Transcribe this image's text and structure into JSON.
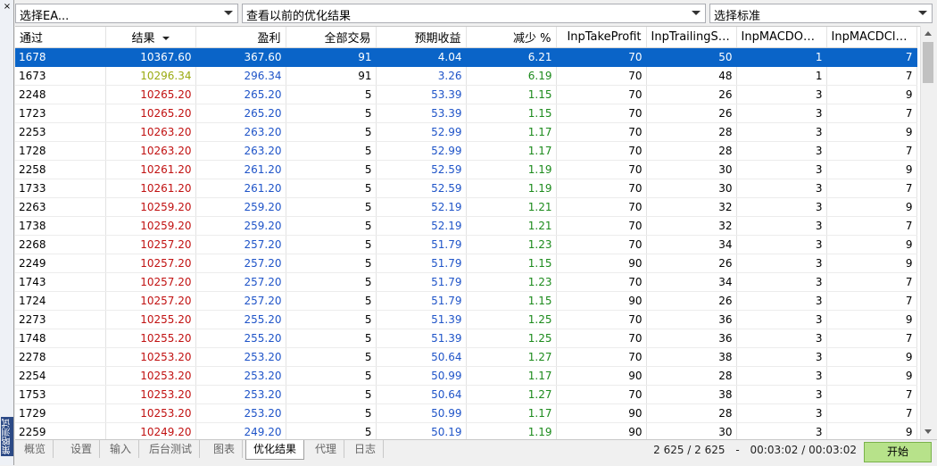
{
  "sidebar": {
    "close_glyph": "×",
    "title": "策略测试"
  },
  "toolbar": {
    "ea_select": "选择EA...",
    "history_select": "查看以前的优化结果",
    "criteria_select": "选择标准"
  },
  "table": {
    "columns": [
      "通过",
      "结果",
      "盈利",
      "全部交易",
      "预期收益",
      "减少 %",
      "InpTakeProfit",
      "InpTrailingStop",
      "InpMACDOp...",
      "InpMACDClos..."
    ],
    "rows": [
      [
        "1678",
        "10367.60",
        "367.60",
        "91",
        "4.04",
        "6.21",
        "70",
        "50",
        "1",
        "7"
      ],
      [
        "1673",
        "10296.34",
        "296.34",
        "91",
        "3.26",
        "6.19",
        "70",
        "48",
        "1",
        "7"
      ],
      [
        "2248",
        "10265.20",
        "265.20",
        "5",
        "53.39",
        "1.15",
        "70",
        "26",
        "3",
        "9"
      ],
      [
        "1723",
        "10265.20",
        "265.20",
        "5",
        "53.39",
        "1.15",
        "70",
        "26",
        "3",
        "7"
      ],
      [
        "2253",
        "10263.20",
        "263.20",
        "5",
        "52.99",
        "1.17",
        "70",
        "28",
        "3",
        "9"
      ],
      [
        "1728",
        "10263.20",
        "263.20",
        "5",
        "52.99",
        "1.17",
        "70",
        "28",
        "3",
        "7"
      ],
      [
        "2258",
        "10261.20",
        "261.20",
        "5",
        "52.59",
        "1.19",
        "70",
        "30",
        "3",
        "9"
      ],
      [
        "1733",
        "10261.20",
        "261.20",
        "5",
        "52.59",
        "1.19",
        "70",
        "30",
        "3",
        "7"
      ],
      [
        "2263",
        "10259.20",
        "259.20",
        "5",
        "52.19",
        "1.21",
        "70",
        "32",
        "3",
        "9"
      ],
      [
        "1738",
        "10259.20",
        "259.20",
        "5",
        "52.19",
        "1.21",
        "70",
        "32",
        "3",
        "7"
      ],
      [
        "2268",
        "10257.20",
        "257.20",
        "5",
        "51.79",
        "1.23",
        "70",
        "34",
        "3",
        "9"
      ],
      [
        "2249",
        "10257.20",
        "257.20",
        "5",
        "51.79",
        "1.15",
        "90",
        "26",
        "3",
        "9"
      ],
      [
        "1743",
        "10257.20",
        "257.20",
        "5",
        "51.79",
        "1.23",
        "70",
        "34",
        "3",
        "7"
      ],
      [
        "1724",
        "10257.20",
        "257.20",
        "5",
        "51.79",
        "1.15",
        "90",
        "26",
        "3",
        "7"
      ],
      [
        "2273",
        "10255.20",
        "255.20",
        "5",
        "51.39",
        "1.25",
        "70",
        "36",
        "3",
        "9"
      ],
      [
        "1748",
        "10255.20",
        "255.20",
        "5",
        "51.39",
        "1.25",
        "70",
        "36",
        "3",
        "7"
      ],
      [
        "2278",
        "10253.20",
        "253.20",
        "5",
        "50.64",
        "1.27",
        "70",
        "38",
        "3",
        "9"
      ],
      [
        "2254",
        "10253.20",
        "253.20",
        "5",
        "50.99",
        "1.17",
        "90",
        "28",
        "3",
        "9"
      ],
      [
        "1753",
        "10253.20",
        "253.20",
        "5",
        "50.64",
        "1.27",
        "70",
        "38",
        "3",
        "7"
      ],
      [
        "1729",
        "10253.20",
        "253.20",
        "5",
        "50.99",
        "1.17",
        "90",
        "28",
        "3",
        "7"
      ],
      [
        "2259",
        "10249.20",
        "249.20",
        "5",
        "50.19",
        "1.19",
        "90",
        "30",
        "3",
        "9"
      ]
    ],
    "selected_row": 0,
    "colors": {
      "result": "#c11111",
      "result_alt": "#9aaa10",
      "profit": "#1f54c8",
      "drawdown": "#1c8a1c",
      "selected_bg": "#0a64c8"
    }
  },
  "tabs": [
    {
      "label": "概览",
      "active": false
    },
    {
      "label": "设置",
      "active": false
    },
    {
      "label": "输入",
      "active": false
    },
    {
      "label": "后台测试",
      "active": false
    },
    {
      "label": "图表",
      "active": false
    },
    {
      "label": "优化结果",
      "active": true
    },
    {
      "label": "代理",
      "active": false
    },
    {
      "label": "日志",
      "active": false
    }
  ],
  "status": {
    "progress": "2 625 / 2 625",
    "separator": "-",
    "time": "00:03:02 / 00:03:02"
  },
  "start_button": "开始"
}
